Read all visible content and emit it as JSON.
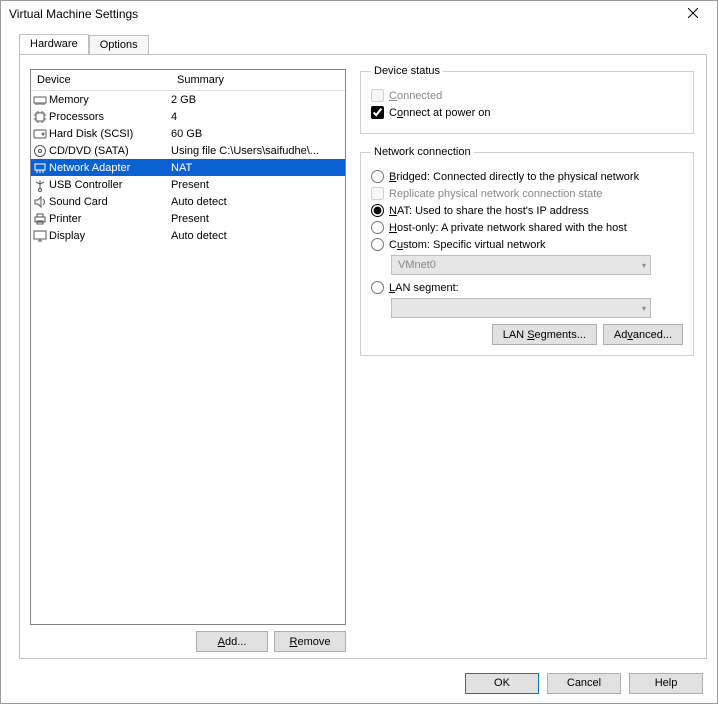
{
  "title": "Virtual Machine Settings",
  "tabs": {
    "hardware": "Hardware",
    "options": "Options"
  },
  "list": {
    "header": {
      "device": "Device",
      "summary": "Summary"
    },
    "rows": [
      {
        "icon": "memory-icon",
        "device": "Memory",
        "summary": "2 GB"
      },
      {
        "icon": "cpu-icon",
        "device": "Processors",
        "summary": "4"
      },
      {
        "icon": "disk-icon",
        "device": "Hard Disk (SCSI)",
        "summary": "60 GB"
      },
      {
        "icon": "cd-icon",
        "device": "CD/DVD (SATA)",
        "summary": "Using file C:\\Users\\saifudhe\\..."
      },
      {
        "icon": "nic-icon",
        "device": "Network Adapter",
        "summary": "NAT"
      },
      {
        "icon": "usb-icon",
        "device": "USB Controller",
        "summary": "Present"
      },
      {
        "icon": "sound-icon",
        "device": "Sound Card",
        "summary": "Auto detect"
      },
      {
        "icon": "printer-icon",
        "device": "Printer",
        "summary": "Present"
      },
      {
        "icon": "display-icon",
        "device": "Display",
        "summary": "Auto detect"
      }
    ]
  },
  "buttons": {
    "add": "Add...",
    "remove": "Remove"
  },
  "deviceStatus": {
    "legend": "Device status",
    "connected": "Connected",
    "powerOn": "Connect at power on"
  },
  "netConn": {
    "legend": "Network connection",
    "bridged": "Bridged: Connected directly to the physical network",
    "replicate": "Replicate physical network connection state",
    "nat": "NAT: Used to share the host's IP address",
    "hostOnly": "Host-only: A private network shared with the host",
    "custom": "Custom: Specific virtual network",
    "customValue": "VMnet0",
    "lanSegment": "LAN segment:",
    "lanSegmentValue": "",
    "lanSegmentsBtn": "LAN Segments...",
    "advancedBtn": "Advanced..."
  },
  "footer": {
    "ok": "OK",
    "cancel": "Cancel",
    "help": "Help"
  }
}
